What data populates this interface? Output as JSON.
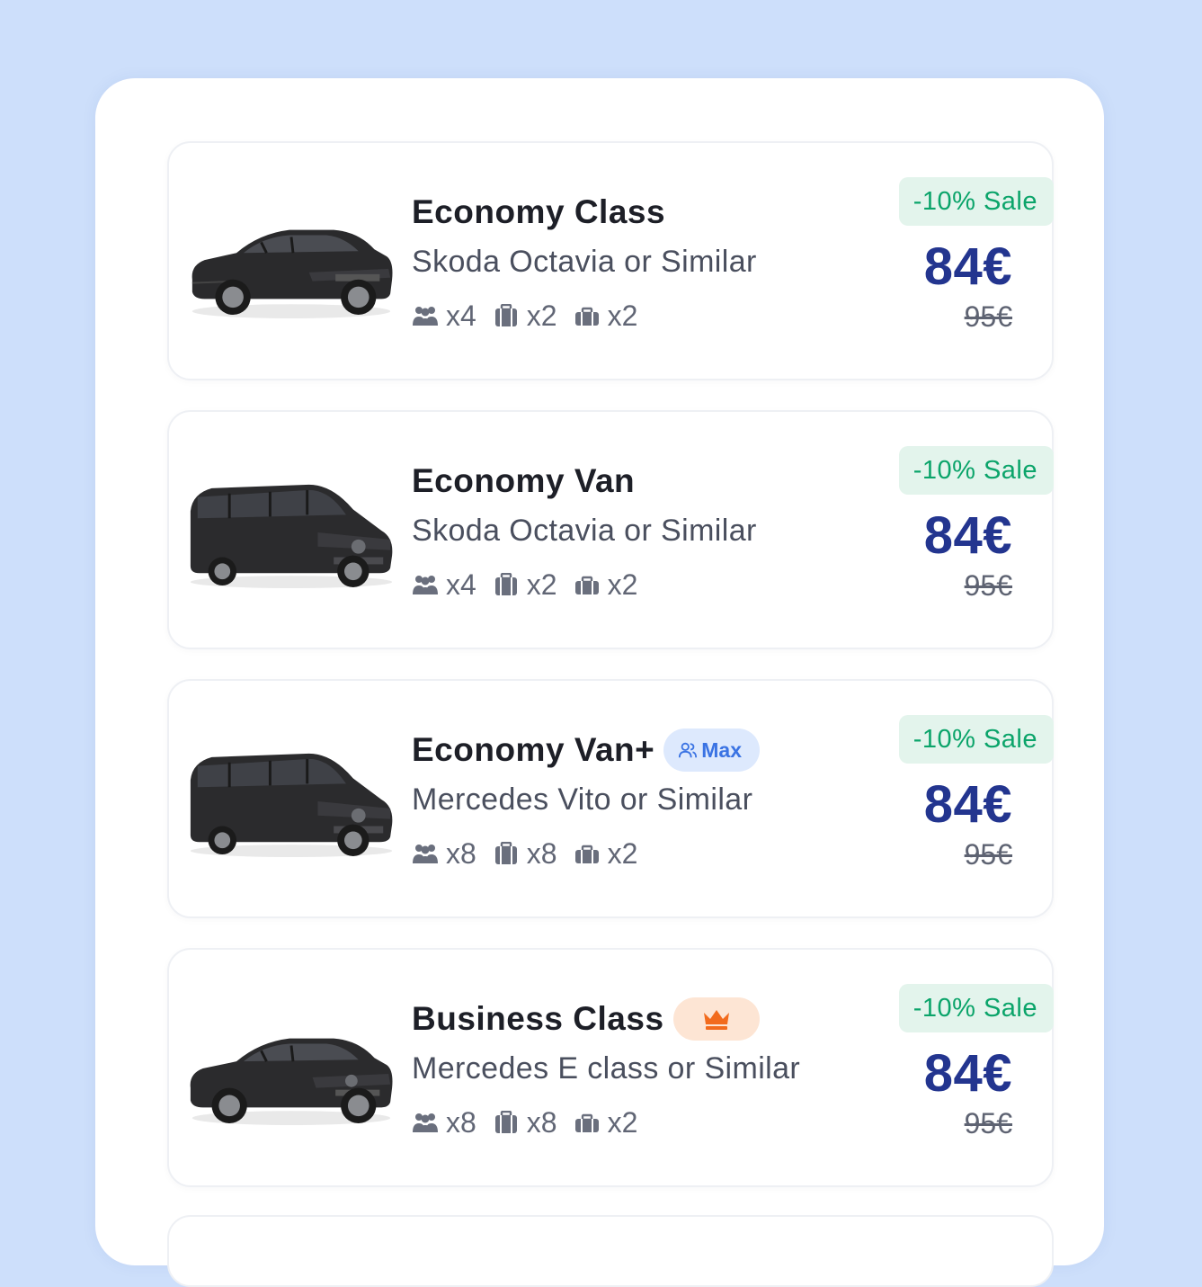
{
  "cars": [
    {
      "title": "Economy Class",
      "subtitle": "Skoda Octavia or Similar",
      "badge": null,
      "passengers": "x4",
      "large_bags": "x2",
      "small_bags": "x2",
      "sale_label": "-10% Sale",
      "price": "84€",
      "old_price": "95€",
      "vehicle_icon": "sedan-image"
    },
    {
      "title": "Economy Van",
      "subtitle": "Skoda Octavia or Similar",
      "badge": null,
      "passengers": "x4",
      "large_bags": "x2",
      "small_bags": "x2",
      "sale_label": "-10% Sale",
      "price": "84€",
      "old_price": "95€",
      "vehicle_icon": "van-image"
    },
    {
      "title": "Economy Van+",
      "subtitle": "Mercedes Vito or Similar",
      "badge": {
        "type": "max",
        "label": "Max"
      },
      "passengers": "x8",
      "large_bags": "x8",
      "small_bags": "x2",
      "sale_label": "-10% Sale",
      "price": "84€",
      "old_price": "95€",
      "vehicle_icon": "van-image"
    },
    {
      "title": "Business Class",
      "subtitle": "Mercedes E class or Similar",
      "badge": {
        "type": "crown",
        "label": ""
      },
      "passengers": "x8",
      "large_bags": "x8",
      "small_bags": "x2",
      "sale_label": "-10% Sale",
      "price": "84€",
      "old_price": "95€",
      "vehicle_icon": "sedan-image"
    }
  ],
  "colors": {
    "page_bg": "#cddffb",
    "price": "#23358f",
    "sale_text": "#0ba46a",
    "sale_bg": "#e3f4ec",
    "max_badge": "#3a73e3",
    "crown": "#f26b1d"
  }
}
